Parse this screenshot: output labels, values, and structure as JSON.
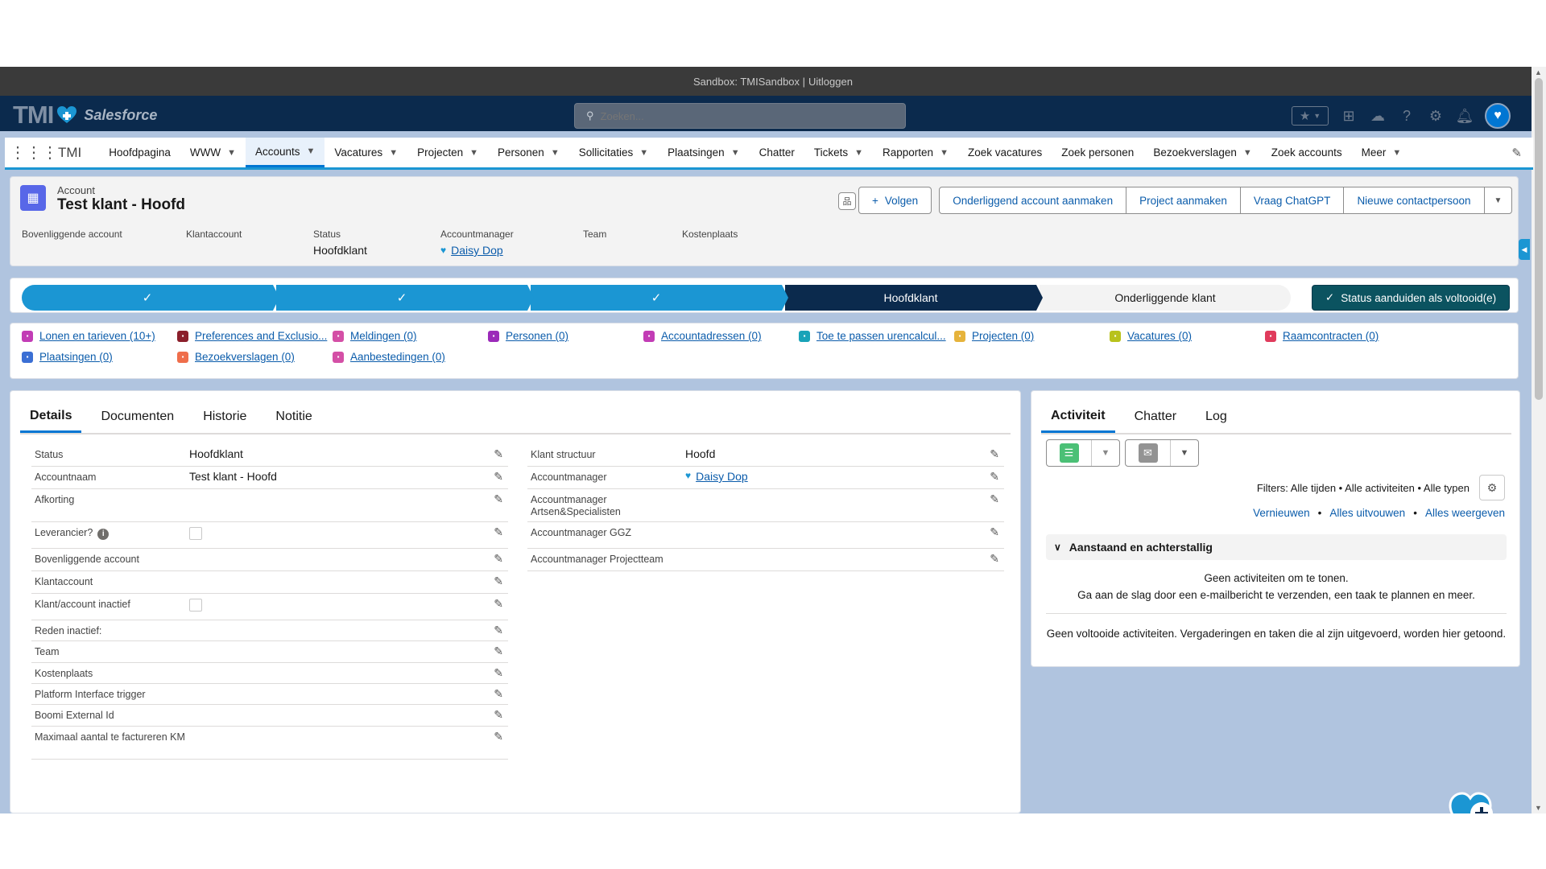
{
  "sandbox": {
    "text": "Sandbox: TMISandbox |",
    "logout": "Uitloggen"
  },
  "header": {
    "logo_text": "TMI",
    "logo_brand": "Salesforce",
    "search_placeholder": "Zoeken..."
  },
  "nav": {
    "app_name": "TMI",
    "items": [
      {
        "label": "Hoofdpagina",
        "chevron": false
      },
      {
        "label": "WWW",
        "chevron": true
      },
      {
        "label": "Accounts",
        "chevron": true,
        "active": true
      },
      {
        "label": "Vacatures",
        "chevron": true
      },
      {
        "label": "Projecten",
        "chevron": true
      },
      {
        "label": "Personen",
        "chevron": true
      },
      {
        "label": "Sollicitaties",
        "chevron": true
      },
      {
        "label": "Plaatsingen",
        "chevron": true
      },
      {
        "label": "Chatter",
        "chevron": false
      },
      {
        "label": "Tickets",
        "chevron": true
      },
      {
        "label": "Rapporten",
        "chevron": true
      },
      {
        "label": "Zoek vacatures",
        "chevron": false
      },
      {
        "label": "Zoek personen",
        "chevron": false
      },
      {
        "label": "Bezoekverslagen",
        "chevron": true
      },
      {
        "label": "Zoek accounts",
        "chevron": false
      },
      {
        "label": "Meer",
        "chevron": true
      }
    ]
  },
  "account": {
    "type_label": "Account",
    "name": "Test klant - Hoofd",
    "buttons": {
      "follow": "Volgen",
      "child": "Onderliggend account aanmaken",
      "project": "Project aanmaken",
      "chatgpt": "Vraag ChatGPT",
      "contact": "Nieuwe contactpersoon"
    },
    "highlights": [
      {
        "label": "Bovenliggende account",
        "value": ""
      },
      {
        "label": "Klantaccount",
        "value": ""
      },
      {
        "label": "Status",
        "value": "Hoofdklant"
      },
      {
        "label": "Accountmanager",
        "value": "Daisy Dop",
        "link": true
      },
      {
        "label": "Team",
        "value": ""
      },
      {
        "label": "Kostenplaats",
        "value": ""
      }
    ]
  },
  "path": {
    "steps": [
      {
        "label": "",
        "state": "done"
      },
      {
        "label": "",
        "state": "done"
      },
      {
        "label": "",
        "state": "done"
      },
      {
        "label": "Hoofdklant",
        "state": "current"
      },
      {
        "label": "Onderliggende klant",
        "state": "todo"
      }
    ],
    "status_button": "Status aanduiden als voltooid(e)"
  },
  "related": [
    {
      "label": "Lonen en tarieven (10+)",
      "color": "#c23cb5"
    },
    {
      "label": "Preferences and Exclusio...",
      "color": "#8b1f2b"
    },
    {
      "label": "Meldingen (0)",
      "color": "#d44fa6"
    },
    {
      "label": "Personen (0)",
      "color": "#9b2ab9"
    },
    {
      "label": "Accountadressen (0)",
      "color": "#c23cb5"
    },
    {
      "label": "Toe te passen urencalcul...",
      "color": "#19a3b8"
    },
    {
      "label": "Projecten (0)",
      "color": "#e6b33b"
    },
    {
      "label": "Vacatures (0)",
      "color": "#b8c21c"
    },
    {
      "label": "Raamcontracten (0)",
      "color": "#e03b5c"
    },
    {
      "label": "Plaatsingen (0)",
      "color": "#3b6fd4"
    },
    {
      "label": "Bezoekverslagen (0)",
      "color": "#ef6e4b"
    },
    {
      "label": "Aanbestedingen (0)",
      "color": "#d44fa6"
    }
  ],
  "details": {
    "tabs": [
      "Details",
      "Documenten",
      "Historie",
      "Notitie"
    ],
    "left_fields": [
      {
        "label": "Status",
        "value": "Hoofdklant"
      },
      {
        "label": "Accountnaam",
        "value": "Test klant - Hoofd"
      },
      {
        "label": "Afkorting",
        "value": ""
      },
      {
        "label": "Leverancier?",
        "value": "",
        "checkbox": true,
        "info": true
      },
      {
        "label": "Bovenliggende account",
        "value": ""
      },
      {
        "label": "Klantaccount",
        "value": ""
      },
      {
        "label": "Klant/account inactief",
        "value": "",
        "checkbox": true
      },
      {
        "label": "Reden inactief:",
        "value": ""
      },
      {
        "label": "Team",
        "value": ""
      },
      {
        "label": "Kostenplaats",
        "value": ""
      },
      {
        "label": "Platform Interface trigger",
        "value": ""
      },
      {
        "label": "Boomi External Id",
        "value": ""
      },
      {
        "label": "Maximaal aantal te factureren KM",
        "value": ""
      }
    ],
    "right_fields": [
      {
        "label": "Klant structuur",
        "value": "Hoofd"
      },
      {
        "label": "Accountmanager",
        "value": "Daisy Dop",
        "link": true
      },
      {
        "label": "Accountmanager Artsen&Specialisten",
        "value": ""
      },
      {
        "label": "Accountmanager GGZ",
        "value": ""
      },
      {
        "label": "Accountmanager Projectteam",
        "value": ""
      }
    ]
  },
  "activity": {
    "tabs": [
      "Activiteit",
      "Chatter",
      "Log"
    ],
    "filters": "Filters: Alle tijden • Alle activiteiten • Alle typen",
    "links": {
      "refresh": "Vernieuwen",
      "expand": "Alles uitvouwen",
      "show": "Alles weergeven",
      "sep": "•"
    },
    "upcoming_title": "Aanstaand en achterstallig",
    "no_activities_1": "Geen activiteiten om te tonen.",
    "no_activities_2": "Ga aan de slag door een e-mailbericht te verzenden, een taak te plannen en meer.",
    "no_completed": "Geen voltooide activiteiten. Vergaderingen en taken die al zijn uitgevoerd, worden hier getoond."
  },
  "colors": {
    "brand": "#0176d3",
    "header": "#0b2a4d",
    "path_done": "#1b96d3",
    "path_current": "#0b2a4d",
    "status_button": "#0b5360",
    "link": "#0b5cab"
  }
}
